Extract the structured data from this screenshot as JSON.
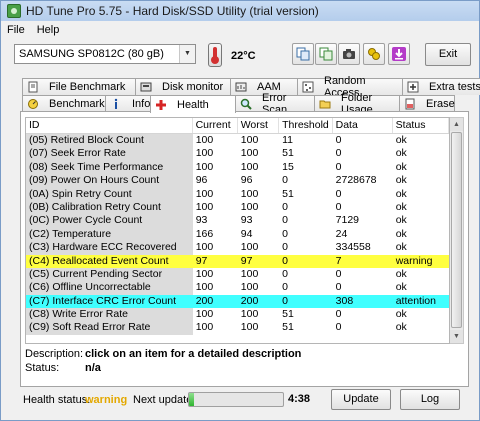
{
  "window": {
    "title": "HD Tune Pro 5.75 - Hard Disk/SSD Utility (trial version)"
  },
  "menu": [
    {
      "label": "File"
    },
    {
      "label": "Help"
    }
  ],
  "toolbar": {
    "drive": "SAMSUNG SP0812C (80 gB)",
    "temperature": "22°C",
    "exit_label": "Exit",
    "icons": [
      "copy-icon",
      "copy-info-icon",
      "camera-icon",
      "options-icon",
      "download-icon"
    ]
  },
  "tabs_top": [
    {
      "label": "File Benchmark",
      "icon": "file-benchmark-icon"
    },
    {
      "label": "Disk monitor",
      "icon": "disk-monitor-icon"
    },
    {
      "label": "AAM",
      "icon": "aam-icon"
    },
    {
      "label": "Random Access",
      "icon": "random-access-icon"
    },
    {
      "label": "Extra tests",
      "icon": "extra-tests-icon"
    }
  ],
  "tabs_bottom": [
    {
      "label": "Benchmark",
      "icon": "benchmark-icon"
    },
    {
      "label": "Info",
      "icon": "info-icon"
    },
    {
      "label": "Health",
      "icon": "health-icon",
      "active": true
    },
    {
      "label": "Error Scan",
      "icon": "error-scan-icon"
    },
    {
      "label": "Folder Usage",
      "icon": "folder-icon"
    },
    {
      "label": "Erase",
      "icon": "erase-icon"
    }
  ],
  "table": {
    "columns": [
      "ID",
      "Current",
      "Worst",
      "Threshold",
      "Data",
      "Status"
    ],
    "rows": [
      {
        "id": "(05) Retired Block Count",
        "current": "100",
        "worst": "100",
        "threshold": "11",
        "data": "0",
        "status": "ok"
      },
      {
        "id": "(07) Seek Error Rate",
        "current": "100",
        "worst": "100",
        "threshold": "51",
        "data": "0",
        "status": "ok"
      },
      {
        "id": "(08) Seek Time Performance",
        "current": "100",
        "worst": "100",
        "threshold": "15",
        "data": "0",
        "status": "ok"
      },
      {
        "id": "(09) Power On Hours Count",
        "current": "96",
        "worst": "96",
        "threshold": "0",
        "data": "2728678",
        "status": "ok"
      },
      {
        "id": "(0A) Spin Retry Count",
        "current": "100",
        "worst": "100",
        "threshold": "51",
        "data": "0",
        "status": "ok"
      },
      {
        "id": "(0B) Calibration Retry Count",
        "current": "100",
        "worst": "100",
        "threshold": "0",
        "data": "0",
        "status": "ok"
      },
      {
        "id": "(0C) Power Cycle Count",
        "current": "93",
        "worst": "93",
        "threshold": "0",
        "data": "7129",
        "status": "ok"
      },
      {
        "id": "(C2) Temperature",
        "current": "166",
        "worst": "94",
        "threshold": "0",
        "data": "24",
        "status": "ok"
      },
      {
        "id": "(C3) Hardware ECC Recovered",
        "current": "100",
        "worst": "100",
        "threshold": "0",
        "data": "334558",
        "status": "ok"
      },
      {
        "id": "(C4) Reallocated Event Count",
        "current": "97",
        "worst": "97",
        "threshold": "0",
        "data": "7",
        "status": "warning",
        "highlight": "#ffff40"
      },
      {
        "id": "(C5) Current Pending Sector",
        "current": "100",
        "worst": "100",
        "threshold": "0",
        "data": "0",
        "status": "ok"
      },
      {
        "id": "(C6) Offline Uncorrectable",
        "current": "100",
        "worst": "100",
        "threshold": "0",
        "data": "0",
        "status": "ok"
      },
      {
        "id": "(C7) Interface CRC Error Count",
        "current": "200",
        "worst": "200",
        "threshold": "0",
        "data": "308",
        "status": "attention",
        "highlight": "#40ffff"
      },
      {
        "id": "(C8) Write Error Rate",
        "current": "100",
        "worst": "100",
        "threshold": "51",
        "data": "0",
        "status": "ok"
      },
      {
        "id": "(C9) Soft Read Error Rate",
        "current": "100",
        "worst": "100",
        "threshold": "51",
        "data": "0",
        "status": "ok"
      }
    ]
  },
  "description": {
    "label": "Description:",
    "value": "click on an item for a detailed description",
    "status_label": "Status:",
    "status_value": "n/a"
  },
  "footer": {
    "health_label": "Health status:",
    "health_value": "warning",
    "health_color": "#e3a800",
    "next_label": "Next update:",
    "progress_fraction": 0.05,
    "timer": "4:38",
    "update_label": "Update",
    "log_label": "Log"
  }
}
